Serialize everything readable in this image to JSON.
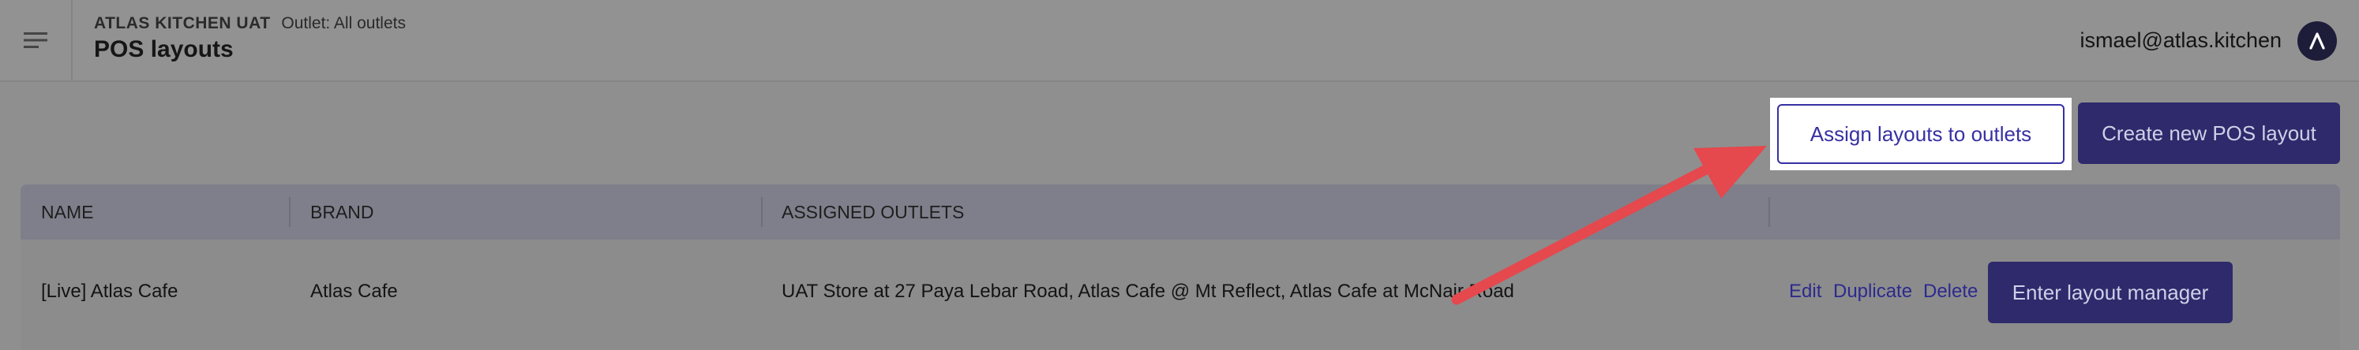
{
  "header": {
    "org_name": "ATLAS KITCHEN UAT",
    "outlet_label": "Outlet: All outlets",
    "page_title": "POS layouts",
    "user_email": "ismael@atlas.kitchen"
  },
  "toolbar": {
    "assign_label": "Assign layouts to outlets",
    "create_label": "Create new POS layout"
  },
  "table": {
    "columns": [
      "NAME",
      "BRAND",
      "ASSIGNED OUTLETS"
    ],
    "rows": [
      {
        "name": "[Live] Atlas Cafe",
        "brand": "Atlas Cafe",
        "outlets": "UAT Store at 27 Paya Lebar Road, Atlas Cafe @ Mt Reflect, Atlas Cafe at McNair Road",
        "actions": {
          "edit": "Edit",
          "duplicate": "Duplicate",
          "delete": "Delete",
          "manager": "Enter layout manager"
        }
      }
    ]
  },
  "colors": {
    "accent": "#3730a3",
    "annotation_arrow": "#e5484d"
  },
  "icons": [
    "menu-icon",
    "atlas-logo-icon"
  ]
}
